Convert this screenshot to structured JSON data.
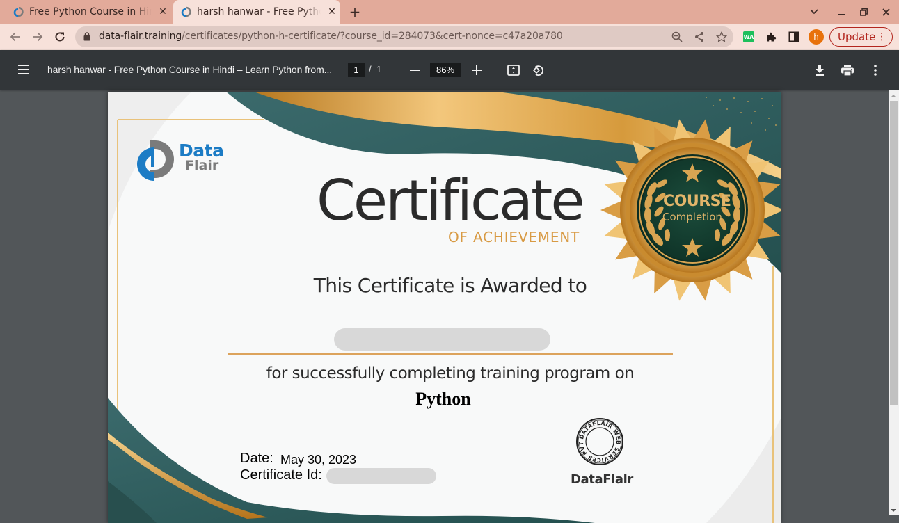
{
  "browser": {
    "tabs": [
      {
        "title": "Free Python Course in Hindi",
        "active": false,
        "favicon": "dataflair-icon"
      },
      {
        "title": "harsh hanwar - Free Python",
        "active": true,
        "favicon": "dataflair-icon"
      }
    ],
    "new_tab_label": "+",
    "url": {
      "host": "data-flair.training",
      "path": "/certificates/python-h-certificate/?course_id=284073&cert-nonce=c47a20a780"
    },
    "profile_initial": "h",
    "update_label": "Update",
    "colors": {
      "tabstrip": "#e2aa9a",
      "toolbar": "#f7e1da",
      "update": "#b3261e",
      "avatar": "#e8710a",
      "whatsapp_ext": "#1dbf5b"
    },
    "extension_wa_label": "WA"
  },
  "pdf_viewer": {
    "title": "harsh hanwar - Free Python Course in Hindi – Learn Python from...",
    "current_page": "1",
    "page_separator": "/",
    "total_pages": "1",
    "zoom": "86%"
  },
  "certificate": {
    "logo": {
      "line1": "Data",
      "line2": "Flair"
    },
    "title": "Certificate",
    "subtitle": "OF ACHIEVEMENT",
    "awarded_text": "This Certificate is Awarded to",
    "recipient_name": "",
    "completion_text": "for successfully completing training program on",
    "course": "Python",
    "date_label": "Date:",
    "date_value": "May 30, 2023",
    "certificate_id_label": "Certificate Id:",
    "certificate_id_value": "",
    "badge": {
      "line1": "COURSE",
      "line2": "Completion"
    },
    "stamp_text": "DATAFLAIR WEB SERVICES PVT. LTD.",
    "signatory": "DataFlair",
    "colors": {
      "teal": "#2f6163",
      "gold": "#d89a43",
      "badge_green": "#133d2f"
    }
  }
}
